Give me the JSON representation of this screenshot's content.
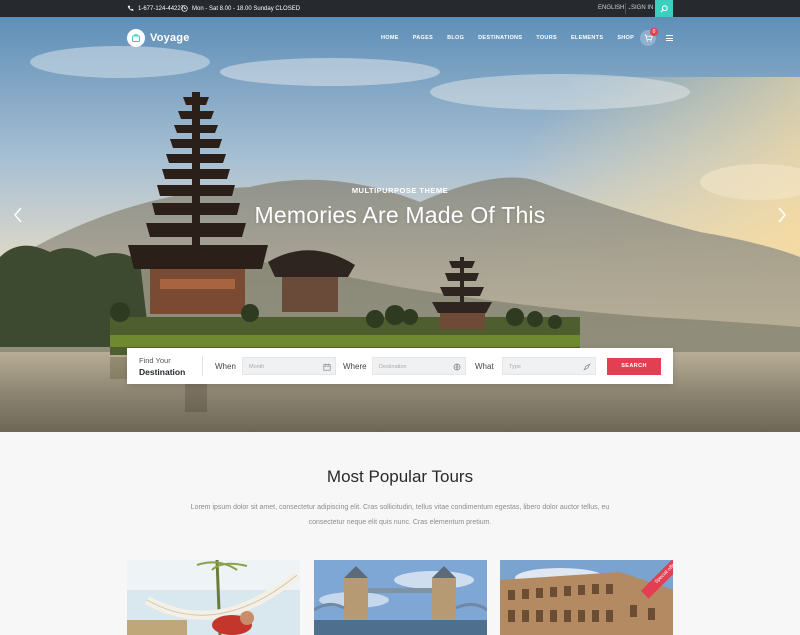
{
  "topbar": {
    "phone": "1-677-124-44227",
    "hours": "Mon - Sat 8.00 - 18.00 Sunday CLOSED",
    "language": "ENGLISH",
    "signin": "SIGN IN"
  },
  "header": {
    "logo": "Voyage",
    "nav": [
      "HOME",
      "PAGES",
      "BLOG",
      "DESTINATIONS",
      "TOURS",
      "ELEMENTS",
      "SHOP"
    ],
    "cart_count": "0"
  },
  "hero": {
    "subtitle": "MULTIPURPOSE THEME",
    "headline": "Memories Are Made Of This"
  },
  "search": {
    "find_line1": "Find Your",
    "find_line2": "Destination",
    "when_label": "When",
    "when_placeholder": "Month",
    "where_label": "Where",
    "where_placeholder": "Destination",
    "what_label": "What",
    "what_placeholder": "Type",
    "button": "SEARCH"
  },
  "tours": {
    "title": "Most Popular Tours",
    "description": "Lorem ipsum dolor sit amet, consectetur adipiscing elit. Cras sollicitudin, tellus vitae condimentum egestas, libero dolor auctor tellus, eu consectetur neque elit quis nunc. Cras elementum pretium.",
    "special_badge": "Special offer"
  },
  "colors": {
    "accent": "#e33e52",
    "teal": "#3ccfc0",
    "topbar": "#26292d"
  }
}
